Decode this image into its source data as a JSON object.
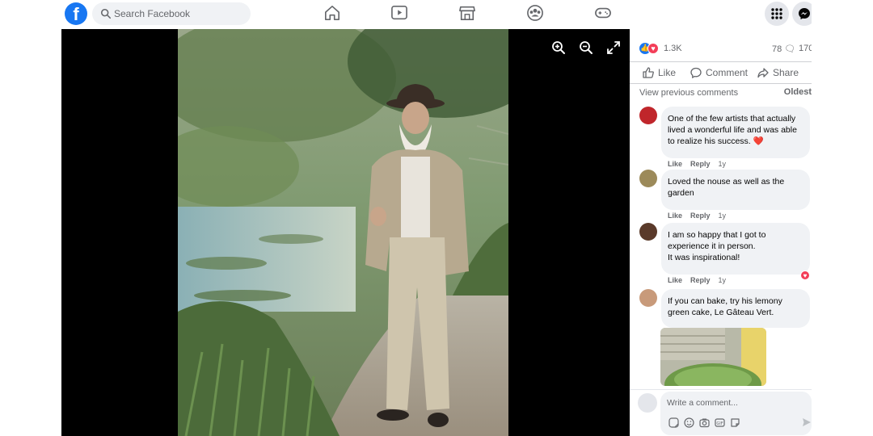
{
  "topbar": {
    "logo": "f",
    "search_placeholder": "Search Facebook",
    "nav_icons": [
      "home-icon",
      "watch-icon",
      "marketplace-icon",
      "groups-icon",
      "gaming-icon"
    ],
    "right_icons": [
      "menu-grid-icon",
      "messenger-icon"
    ]
  },
  "media": {
    "tools": [
      "zoom-in-icon",
      "zoom-out-icon",
      "fullscreen-icon"
    ]
  },
  "post": {
    "reactions_count": "1.3K",
    "comments_count": "78",
    "shares_count": "170",
    "actions": {
      "like": "Like",
      "comment": "Comment",
      "share": "Share"
    },
    "view_previous": "View previous comments",
    "sort": "Oldest"
  },
  "comments": [
    {
      "text": "One of the few artists that actually lived a wonderful life and was able to realize his success. ❤️",
      "like": "Like",
      "reply": "Reply",
      "time": "1y",
      "avatar_color": "#c0262b"
    },
    {
      "text": "Loved the nouse as well as the garden",
      "like": "Like",
      "reply": "Reply",
      "time": "1y",
      "avatar_color": "#9c8a5a"
    },
    {
      "text": "I am so happy that I got to experience it in person.\nIt was inspirational!",
      "like": "Like",
      "reply": "Reply",
      "time": "1y",
      "avatar_color": "#5a3a2a"
    },
    {
      "text": "If you can bake, try his lemony green cake, Le Gâteau Vert.",
      "like": "",
      "reply": "",
      "time": "",
      "avatar_color": "#c89a7a"
    }
  ],
  "composer": {
    "placeholder": "Write a comment...",
    "icons": [
      "sticker-icon",
      "emoji-icon",
      "camera-icon",
      "gif-icon",
      "sticker-alt-icon"
    ]
  },
  "colors": {
    "brand": "#1877f2",
    "love": "#f33e58",
    "bubble": "#f0f2f5",
    "muted": "#65676b"
  }
}
